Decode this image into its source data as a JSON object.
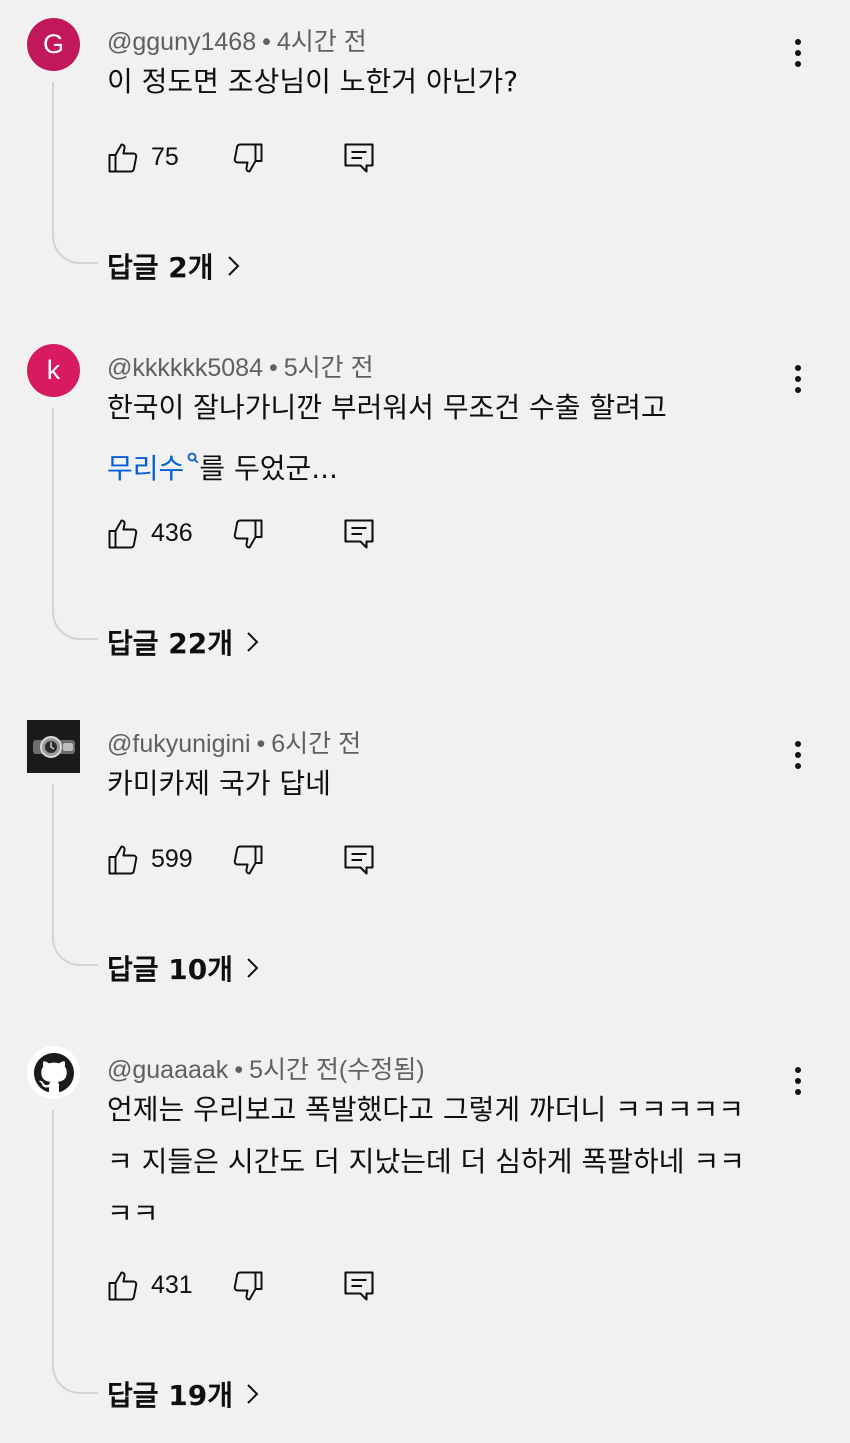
{
  "comments": [
    {
      "avatar_letter": "G",
      "avatar_color": "#c2185b",
      "handle": "@gguny1468",
      "time": "4시간 전",
      "lines": [
        "이 정도면 조상님이 노한거 아닌가?"
      ],
      "likes": "75",
      "replies_label": "답글 2개"
    },
    {
      "avatar_letter": "k",
      "avatar_color": "#d81b60",
      "handle": "@kkkkkk5084",
      "time": "5시간 전",
      "lines": [
        "한국이 잘나가니깐 부러워서 무조건 수출 할려고"
      ],
      "link_text": "무리수",
      "after_link": "를 두었군...",
      "likes": "436",
      "replies_label": "답글 22개"
    },
    {
      "avatar_icon": "watch-avatar-icon",
      "handle": "@fukyunigini",
      "time": "6시간 전",
      "lines": [
        "카미카제 국가 답네"
      ],
      "likes": "599",
      "replies_label": "답글 10개"
    },
    {
      "avatar_icon": "github-octocat-avatar-icon",
      "handle": "@guaaaak",
      "time": "5시간 전(수정됨)",
      "lines": [
        "언제는 우리보고 폭발했다고 그렇게 까더니 ㅋㅋㅋㅋㅋ",
        "ㅋ 지들은 시간도 더 지났는데 더 심하게 폭팔하네 ㅋㅋ",
        "ㅋㅋ"
      ],
      "likes": "431",
      "replies_label": "답글 19개"
    }
  ],
  "dot_separator": "•",
  "colors": {
    "background": "#f1f1f1",
    "meta_text": "#606060",
    "link": "#065fd4",
    "thread_line": "#d3d3d3"
  }
}
